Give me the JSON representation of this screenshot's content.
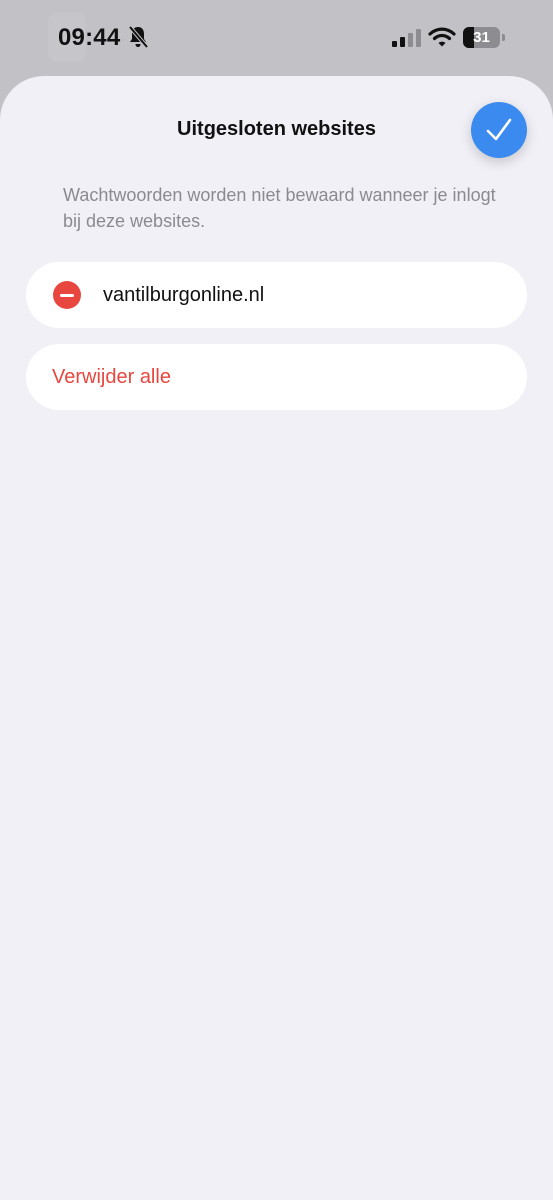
{
  "status_bar": {
    "time": "09:44",
    "battery_level": "31",
    "battery_fraction": 0.31,
    "icons": [
      "bell-slash-icon",
      "signal-icon",
      "wifi-icon",
      "battery-icon"
    ]
  },
  "sheet": {
    "title": "Uitgesloten websites",
    "done_icon": "checkmark-icon",
    "description": "Wachtwoorden worden niet bewaard wanneer je inlogt bij deze websites.",
    "excluded_sites": [
      {
        "label": "vantilburgonline.nl",
        "icon": "remove-icon"
      }
    ],
    "delete_all_label": "Verwijder alle"
  },
  "colors": {
    "accent": "#3a8af0",
    "destructive": "#e8473f",
    "background": "#f1f0f6"
  }
}
